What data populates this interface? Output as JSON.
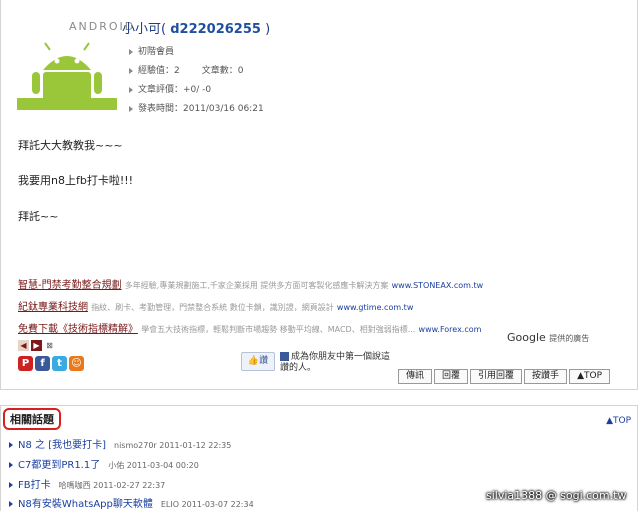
{
  "author": {
    "platform_word": "ANDROID",
    "name": "小小可(",
    "uid": "d222026255",
    "close": ")",
    "meta": {
      "rank": "初階會員",
      "exp": "經驗值：2",
      "posts": "文章數：0",
      "rating": "文章評價：+0/ -0",
      "posted": "發表時間：2011/03/16 06:21"
    }
  },
  "post": {
    "lines": [
      "拜託大大教教我~~~",
      "我要用n8上fb打卡啦!!!",
      "拜託~~"
    ]
  },
  "ads": [
    {
      "title": "智慧-門禁考勤整合規劃",
      "desc": "多年經驗,專業規劃施工,千家企業採用 提供多方面可客製化感應卡解決方案",
      "url": "www.STONEAX.com.tw"
    },
    {
      "title": "紀鈦專業科技網",
      "desc": "指紋、刷卡、考勤管理，門禁整合系統 數位卡鎖，識別證，網頁設計",
      "url": "www.gtime.com.tw"
    },
    {
      "title": "免費下載《技術指標精解》",
      "desc": "學會五大技術指標，輕鬆判斷市場趨勢 移動平均線、MACD、相對強弱指標...",
      "url": "www.Forex.com"
    }
  ],
  "google": {
    "brand": "Google",
    "label": "提供的廣告"
  },
  "facebook": {
    "like": "讚",
    "prompt": "成為你朋友中第一個說這讚的人。"
  },
  "buttons": [
    "傳訊",
    "回覆",
    "引用回覆",
    "按讚手",
    "▲TOP"
  ],
  "related": {
    "title": "相關話題",
    "top": "▲TOP",
    "items": [
      {
        "title": "N8 之 [我也要打卡]",
        "meta": "nismo270r 2011-01-12 22:35"
      },
      {
        "title": "C7都更到PR1.1了",
        "meta": "小佑 2011-03-04 00:20"
      },
      {
        "title": "FB打卡",
        "meta": "哈嗎咖西 2011-02-27 22:37"
      },
      {
        "title": "N8有安裝WhatsApp聊天軟體",
        "meta": "ELIO 2011-03-07 22:34"
      }
    ]
  },
  "watermark": "silvia1388  @ sogi.com.tw",
  "colors": {
    "android_green": "#9ac63a",
    "link_blue": "#1b3f9f",
    "ad_title": "#7a1a1a",
    "highlight_red": "#d82020"
  }
}
